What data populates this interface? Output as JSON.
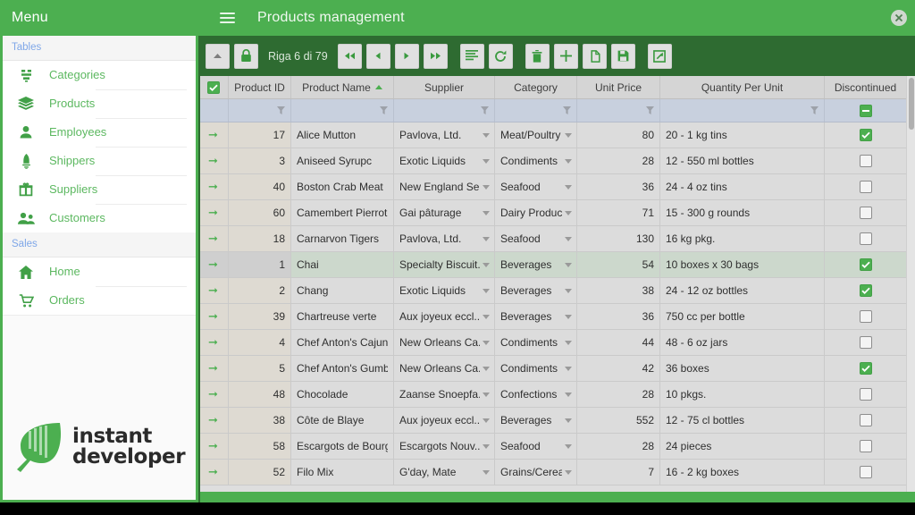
{
  "sidebar": {
    "title": "Menu",
    "groups": [
      {
        "title": "Tables",
        "items": [
          {
            "label": "Categories",
            "icon": "categories-icon"
          },
          {
            "label": "Products",
            "icon": "layers-icon"
          },
          {
            "label": "Employees",
            "icon": "person-icon"
          },
          {
            "label": "Shippers",
            "icon": "rocket-icon"
          },
          {
            "label": "Suppliers",
            "icon": "gift-icon"
          },
          {
            "label": "Customers",
            "icon": "people-icon"
          }
        ]
      },
      {
        "title": "Sales",
        "items": [
          {
            "label": "Home",
            "icon": "home-icon"
          },
          {
            "label": "Orders",
            "icon": "cart-icon"
          }
        ]
      }
    ],
    "logo": {
      "line1": "instant",
      "line2": "developer"
    }
  },
  "header": {
    "title": "Products management",
    "menu_icon": "hamburger-icon",
    "close_icon": "close-circle-icon"
  },
  "toolbar": {
    "collapse_label": "",
    "lock_label": "",
    "row_counter": "Riga 6 di 79",
    "buttons": [
      {
        "name": "collapse-button",
        "icon": "caret-up-icon"
      },
      {
        "name": "lock-button",
        "icon": "lock-icon"
      },
      {
        "name": "first-page-button",
        "icon": "double-left-icon"
      },
      {
        "name": "previous-page-button",
        "icon": "left-icon"
      },
      {
        "name": "next-page-button",
        "icon": "right-icon"
      },
      {
        "name": "last-page-button",
        "icon": "double-right-icon"
      },
      {
        "name": "list-view-button",
        "icon": "list-icon"
      },
      {
        "name": "refresh-button",
        "icon": "refresh-icon"
      },
      {
        "name": "delete-button",
        "icon": "trash-icon"
      },
      {
        "name": "add-button",
        "icon": "plus-icon"
      },
      {
        "name": "duplicate-button",
        "icon": "document-icon"
      },
      {
        "name": "save-button",
        "icon": "floppy-icon"
      },
      {
        "name": "export-button",
        "icon": "external-link-icon"
      }
    ]
  },
  "grid": {
    "columns": [
      {
        "key": "select",
        "label": ""
      },
      {
        "key": "product_id",
        "label": "Product ID"
      },
      {
        "key": "product_name",
        "label": "Product Name",
        "sorted": "asc"
      },
      {
        "key": "supplier",
        "label": "Supplier"
      },
      {
        "key": "category",
        "label": "Category"
      },
      {
        "key": "unit_price",
        "label": "Unit Price"
      },
      {
        "key": "quantity_per_unit",
        "label": "Quantity Per Unit"
      },
      {
        "key": "discontinued",
        "label": "Discontinued"
      }
    ],
    "filter_row": {
      "discontinued_state": "indeterminate"
    },
    "rows": [
      {
        "id": "17",
        "name": "Alice Mutton",
        "supplier": "Pavlova, Ltd.",
        "category": "Meat/Poultry",
        "price": "80",
        "qty": "20 - 1 kg tins",
        "discontinued": true,
        "selected": false
      },
      {
        "id": "3",
        "name": "Aniseed Syrupc",
        "supplier": "Exotic Liquids",
        "category": "Condiments",
        "price": "28",
        "qty": "12 - 550 ml bottles",
        "discontinued": false,
        "selected": false
      },
      {
        "id": "40",
        "name": "Boston Crab Meat",
        "supplier": "New England Se...",
        "category": "Seafood",
        "price": "36",
        "qty": "24 - 4 oz tins",
        "discontinued": false,
        "selected": false
      },
      {
        "id": "60",
        "name": "Camembert Pierrot",
        "supplier": "Gai pâturage",
        "category": "Dairy Products",
        "price": "71",
        "qty": "15 - 300 g rounds",
        "discontinued": false,
        "selected": false
      },
      {
        "id": "18",
        "name": "Carnarvon Tigers",
        "supplier": "Pavlova, Ltd.",
        "category": "Seafood",
        "price": "130",
        "qty": "16 kg pkg.",
        "discontinued": false,
        "selected": false
      },
      {
        "id": "1",
        "name": "Chai",
        "supplier": "Specialty Biscuit...",
        "category": "Beverages",
        "price": "54",
        "qty": "10 boxes x 30 bags",
        "discontinued": true,
        "selected": true
      },
      {
        "id": "2",
        "name": "Chang",
        "supplier": "Exotic Liquids",
        "category": "Beverages",
        "price": "38",
        "qty": "24 - 12 oz bottles",
        "discontinued": true,
        "selected": false
      },
      {
        "id": "39",
        "name": "Chartreuse verte",
        "supplier": "Aux joyeux eccl...",
        "category": "Beverages",
        "price": "36",
        "qty": "750 cc per bottle",
        "discontinued": false,
        "selected": false
      },
      {
        "id": "4",
        "name": "Chef Anton's Cajun Seasoning",
        "supplier": "New Orleans Ca...",
        "category": "Condiments",
        "price": "44",
        "qty": "48 - 6 oz jars",
        "discontinued": false,
        "selected": false
      },
      {
        "id": "5",
        "name": "Chef Anton's Gumbo Mix",
        "supplier": "New Orleans Ca...",
        "category": "Condiments",
        "price": "42",
        "qty": "36 boxes",
        "discontinued": true,
        "selected": false
      },
      {
        "id": "48",
        "name": "Chocolade",
        "supplier": "Zaanse Snoepfa...",
        "category": "Confections",
        "price": "28",
        "qty": "10 pkgs.",
        "discontinued": false,
        "selected": false
      },
      {
        "id": "38",
        "name": "Côte de Blaye",
        "supplier": "Aux joyeux eccl...",
        "category": "Beverages",
        "price": "552",
        "qty": "12 - 75 cl bottles",
        "discontinued": false,
        "selected": false
      },
      {
        "id": "58",
        "name": "Escargots de Bourgogne",
        "supplier": "Escargots Nouv...",
        "category": "Seafood",
        "price": "28",
        "qty": "24 pieces",
        "discontinued": false,
        "selected": false
      },
      {
        "id": "52",
        "name": "Filo Mix",
        "supplier": "G'day, Mate",
        "category": "Grains/Cereals",
        "price": "7",
        "qty": "16 - 2 kg boxes",
        "discontinued": false,
        "selected": false
      }
    ]
  },
  "colors": {
    "brand_green": "#4caf50",
    "toolbar_green": "#2e6b31",
    "link_green": "#5cb860",
    "group_blue": "#7fa7e8",
    "filter_row": "#c8d0de"
  }
}
